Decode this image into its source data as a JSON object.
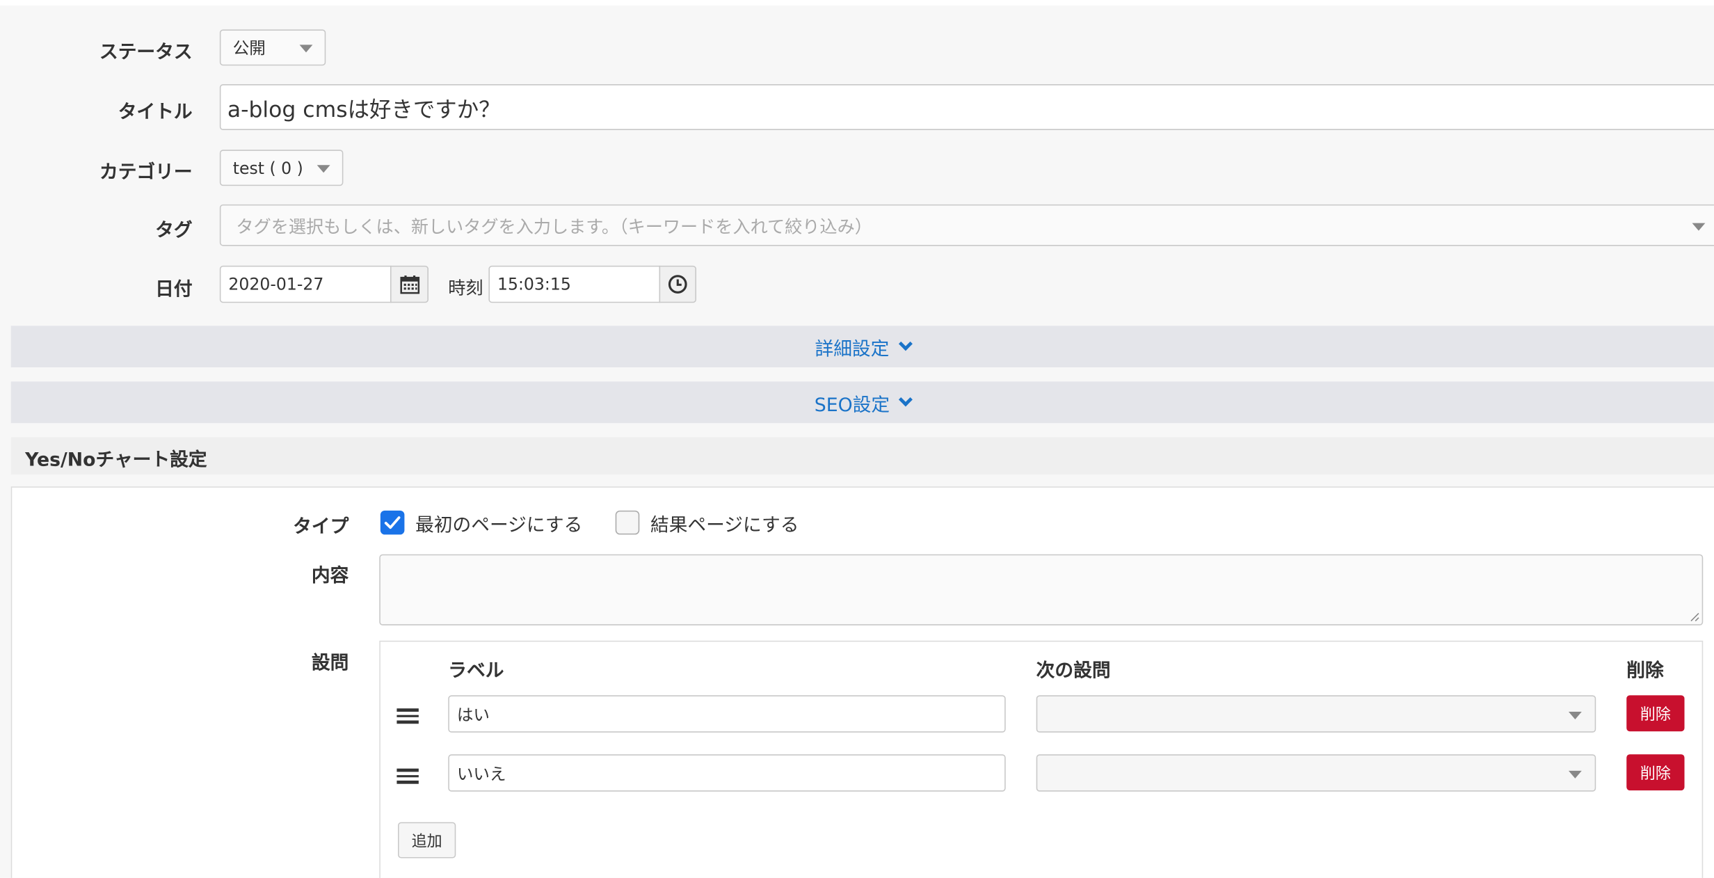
{
  "form": {
    "status": {
      "label": "ステータス",
      "value": "公開"
    },
    "title": {
      "label": "タイトル",
      "value": "a-blog cmsは好きですか？"
    },
    "category": {
      "label": "カテゴリー",
      "value": "test ( 0 )"
    },
    "tag": {
      "label": "タグ",
      "placeholder": "タグを選択もしくは、新しいタグを入力します。（キーワードを入れて絞り込み）"
    },
    "date": {
      "label": "日付",
      "value": "2020-01-27",
      "icon": "calendar-icon"
    },
    "time": {
      "label": "時刻",
      "value": "15:03:15",
      "icon": "clock-icon"
    }
  },
  "accordions": {
    "detail": "詳細設定",
    "seo": "SEO設定"
  },
  "yesno": {
    "section_title": "Yes/Noチャート設定",
    "type": {
      "label": "タイプ",
      "options": [
        {
          "label": "最初のページにする",
          "checked": true
        },
        {
          "label": "結果ページにする",
          "checked": false
        }
      ]
    },
    "content": {
      "label": "内容",
      "value": ""
    },
    "questions": {
      "label": "設問",
      "headers": {
        "label": "ラベル",
        "next": "次の設問",
        "delete": "削除"
      },
      "rows": [
        {
          "label": "はい",
          "next": "",
          "delete_label": "削除"
        },
        {
          "label": "いいえ",
          "next": "",
          "delete_label": "削除"
        }
      ],
      "add_label": "追加"
    }
  },
  "colors": {
    "accent": "#1a73c8",
    "danger": "#c8102e",
    "checkbox_checked": "#1a73e8"
  }
}
